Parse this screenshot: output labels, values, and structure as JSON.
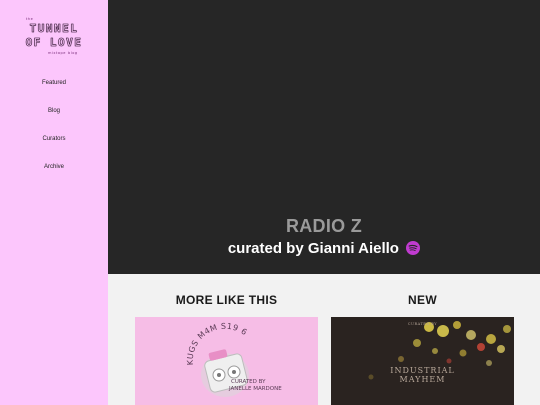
{
  "logo": {
    "top_small": "the",
    "line1": "TUNNEL",
    "line2": "OF LOVE",
    "bottom_small_left": "mixtape",
    "bottom_small_right": "blog"
  },
  "nav": {
    "items": [
      {
        "label": "Featured"
      },
      {
        "label": "Blog"
      },
      {
        "label": "Curators"
      },
      {
        "label": "Archive"
      }
    ]
  },
  "hero": {
    "title": "RADIO Z",
    "subtitle": "curated by Gianni Aiello",
    "icon": "spotify-icon",
    "accent": "#c03bd0"
  },
  "sections": {
    "more_like_this": "MORE LIKE THIS",
    "new": "NEW"
  },
  "cards": {
    "pink": {
      "arc_text": "KUGS M4M S19 6",
      "curator_line1": "CURATED BY",
      "curator_line2": "JANELLE MARDONE"
    },
    "dark": {
      "small_line1": "CURATED BY",
      "small_line2": "",
      "title_line1": "INDUSTRIAL",
      "title_line2": "MAYHEM"
    }
  }
}
